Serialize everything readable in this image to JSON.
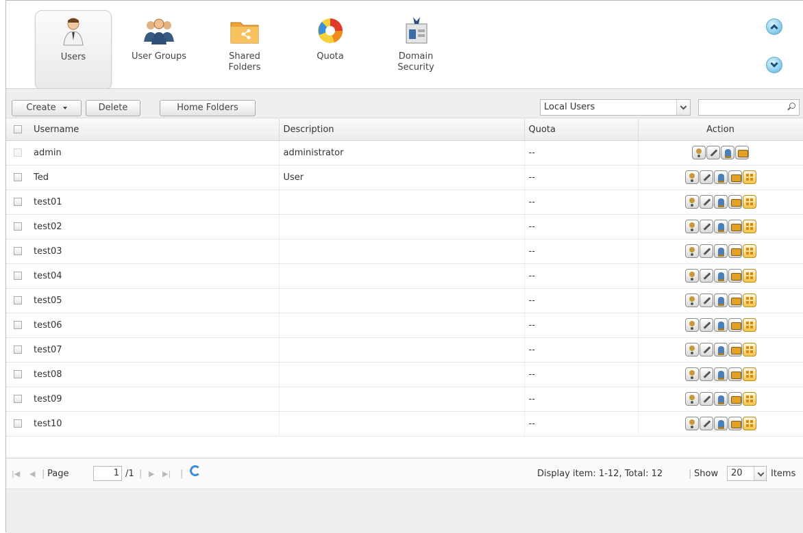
{
  "apps": [
    {
      "label": "Users",
      "icon": "user-icon",
      "active": true
    },
    {
      "label": "User Groups",
      "icon": "user-groups-icon",
      "active": false
    },
    {
      "label": "Shared\nFolders",
      "icon": "shared-folder-icon",
      "active": false
    },
    {
      "label": "Quota",
      "icon": "quota-icon",
      "active": false
    },
    {
      "label": "Domain\nSecurity",
      "icon": "domain-security-icon",
      "active": false
    }
  ],
  "toolbar": {
    "create_label": "Create",
    "delete_label": "Delete",
    "home_folders_label": "Home Folders",
    "filter_value": "Local Users",
    "search_value": ""
  },
  "table": {
    "columns": [
      "Username",
      "Description",
      "Quota",
      "Action"
    ],
    "rows": [
      {
        "username": "admin",
        "description": "administrator",
        "quota": "--",
        "selectable": false,
        "actions": [
          "password",
          "edit",
          "groups",
          "folders"
        ]
      },
      {
        "username": "Ted",
        "description": "User",
        "quota": "--",
        "selectable": true,
        "actions": [
          "password",
          "edit",
          "groups",
          "folders",
          "quota"
        ]
      },
      {
        "username": "test01",
        "description": "",
        "quota": "--",
        "selectable": true,
        "actions": [
          "password",
          "edit",
          "groups",
          "folders",
          "quota"
        ]
      },
      {
        "username": "test02",
        "description": "",
        "quota": "--",
        "selectable": true,
        "actions": [
          "password",
          "edit",
          "groups",
          "folders",
          "quota"
        ]
      },
      {
        "username": "test03",
        "description": "",
        "quota": "--",
        "selectable": true,
        "actions": [
          "password",
          "edit",
          "groups",
          "folders",
          "quota"
        ]
      },
      {
        "username": "test04",
        "description": "",
        "quota": "--",
        "selectable": true,
        "actions": [
          "password",
          "edit",
          "groups",
          "folders",
          "quota"
        ]
      },
      {
        "username": "test05",
        "description": "",
        "quota": "--",
        "selectable": true,
        "actions": [
          "password",
          "edit",
          "groups",
          "folders",
          "quota"
        ]
      },
      {
        "username": "test06",
        "description": "",
        "quota": "--",
        "selectable": true,
        "actions": [
          "password",
          "edit",
          "groups",
          "folders",
          "quota"
        ]
      },
      {
        "username": "test07",
        "description": "",
        "quota": "--",
        "selectable": true,
        "actions": [
          "password",
          "edit",
          "groups",
          "folders",
          "quota"
        ]
      },
      {
        "username": "test08",
        "description": "",
        "quota": "--",
        "selectable": true,
        "actions": [
          "password",
          "edit",
          "groups",
          "folders",
          "quota"
        ]
      },
      {
        "username": "test09",
        "description": "",
        "quota": "--",
        "selectable": true,
        "actions": [
          "password",
          "edit",
          "groups",
          "folders",
          "quota"
        ]
      },
      {
        "username": "test10",
        "description": "",
        "quota": "--",
        "selectable": true,
        "actions": [
          "password",
          "edit",
          "groups",
          "folders",
          "quota"
        ]
      }
    ]
  },
  "pager": {
    "page_label": "Page",
    "page_value": "1",
    "page_total": "/1",
    "display_text": "Display item: 1-12, Total: 12",
    "show_label": "Show",
    "show_value": "20",
    "items_label": "Items"
  }
}
